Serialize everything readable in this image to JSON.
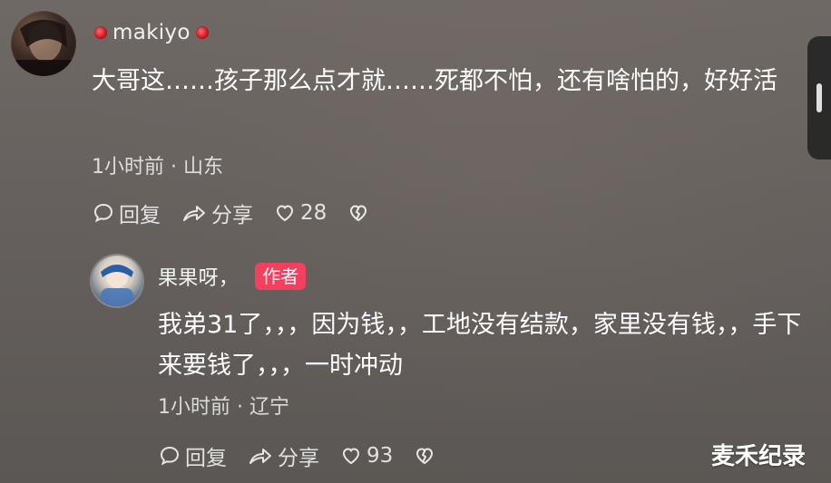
{
  "comments": [
    {
      "username": "makiyo",
      "text": "大哥这……孩子那么点才就……死都不怕，还有啥怕的，好好活",
      "time_location": "1小时前 · 山东",
      "actions": {
        "reply_label": "回复",
        "share_label": "分享",
        "like_count": "28"
      }
    },
    {
      "username": "果果呀，",
      "author_tag": "作者",
      "text": "我弟31了，，，因为钱，，工地没有结款，家里没有钱，，手下来要钱了，，，一时冲动",
      "time_location": "1小时前 · 辽宁",
      "actions": {
        "reply_label": "回复",
        "share_label": "分享",
        "like_count": "93"
      }
    }
  ],
  "watermark": "麦禾纪录",
  "icons": {
    "reply": "speech-bubble-icon",
    "share": "share-arrow-icon",
    "like": "heart-icon",
    "dislike": "broken-heart-icon"
  }
}
